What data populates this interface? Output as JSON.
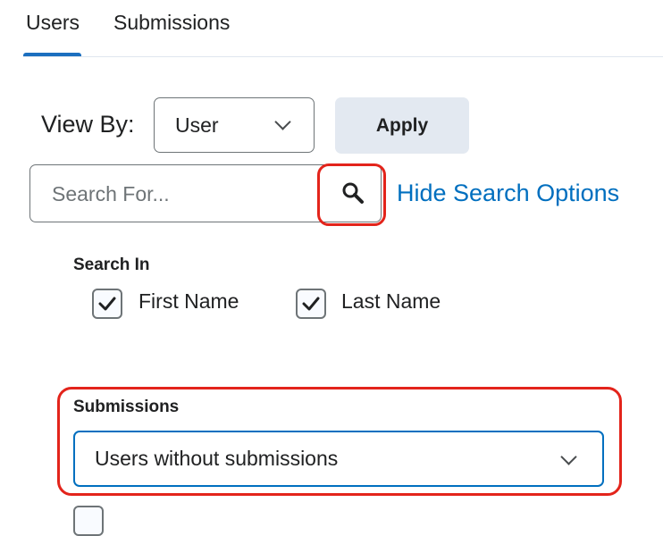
{
  "tabs": [
    {
      "label": "Users",
      "selected": true
    },
    {
      "label": "Submissions",
      "selected": false
    }
  ],
  "view_by": {
    "label": "View By:",
    "selected": "User",
    "apply_label": "Apply"
  },
  "search": {
    "placeholder": "Search For...",
    "hide_options_label": "Hide Search Options"
  },
  "search_in": {
    "label": "Search In",
    "options": [
      {
        "label": "First Name",
        "checked": true
      },
      {
        "label": "Last Name",
        "checked": true
      }
    ]
  },
  "submissions_filter": {
    "label": "Submissions",
    "selected": "Users without submissions"
  },
  "icons": {
    "search": "magnifier-icon",
    "dropdown": "chevron-down-icon",
    "check": "checkmark-icon"
  },
  "colors": {
    "accent": "#006fbf",
    "tab_indicator": "#1c6fbf",
    "highlight": "#e3241b",
    "button_bg": "#e3e9f1",
    "text": "#202122"
  }
}
